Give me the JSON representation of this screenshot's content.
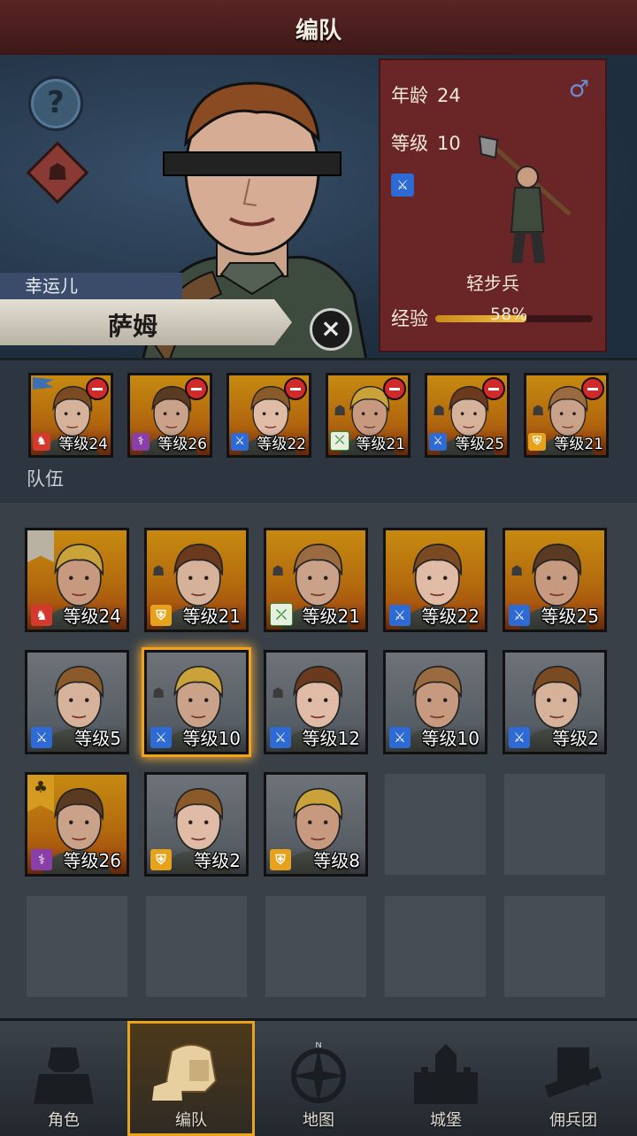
{
  "title": "编队",
  "hero": {
    "help_icon": "?",
    "tag": "幸运儿",
    "name": "萨姆",
    "close_icon": "×",
    "stats": {
      "age_label": "年龄",
      "age": "24",
      "gender_icon": "♂",
      "level_label": "等级",
      "level": "10",
      "class_name": "轻步兵",
      "xp_label": "经验",
      "xp_percent_text": "58%",
      "xp_fraction": 0.58
    }
  },
  "squad": {
    "label": "队伍",
    "members": [
      {
        "class": "horse",
        "level": "等级24"
      },
      {
        "class": "staff",
        "level": "等级26"
      },
      {
        "class": "sword",
        "level": "等级22"
      },
      {
        "class": "bow",
        "level": "等级21"
      },
      {
        "class": "sword",
        "level": "等级25"
      },
      {
        "class": "shield",
        "level": "等级21"
      }
    ]
  },
  "roster": [
    {
      "class": "horse",
      "level": "等级24",
      "bg": "gold"
    },
    {
      "class": "shield",
      "level": "等级21",
      "bg": "gold"
    },
    {
      "class": "bow",
      "level": "等级21",
      "bg": "gold"
    },
    {
      "class": "sword",
      "level": "等级22",
      "bg": "gold"
    },
    {
      "class": "sword",
      "level": "等级25",
      "bg": "gold"
    },
    {
      "class": "sword",
      "level": "等级5",
      "bg": "grey"
    },
    {
      "class": "sword",
      "level": "等级10",
      "bg": "grey"
    },
    {
      "class": "sword",
      "level": "等级12",
      "bg": "grey"
    },
    {
      "class": "sword",
      "level": "等级10",
      "bg": "grey"
    },
    {
      "class": "sword",
      "level": "等级2",
      "bg": "grey"
    },
    {
      "class": "staff",
      "level": "等级26",
      "bg": "gold"
    },
    {
      "class": "shield",
      "level": "等级2",
      "bg": "grey"
    },
    {
      "class": "shield",
      "level": "等级8",
      "bg": "grey"
    }
  ],
  "nav": [
    {
      "label": "角色",
      "icon": "knight-icon"
    },
    {
      "label": "编队",
      "icon": "formation-helmet-icon"
    },
    {
      "label": "地图",
      "icon": "compass-icon"
    },
    {
      "label": "城堡",
      "icon": "castle-icon"
    },
    {
      "label": "佣兵团",
      "icon": "mercenary-banner-icon"
    }
  ],
  "compass_letter": "N",
  "class_glyphs": {
    "sword": "⚔",
    "shield": "⛨",
    "bow": "⤫",
    "staff": "⚕",
    "horse": "♞"
  },
  "colors": {
    "title_bar": "#4e1f1f",
    "stats_card": "#6a2527",
    "selected_glow": "#f0a318",
    "xp_fill": "#f3c24a"
  }
}
